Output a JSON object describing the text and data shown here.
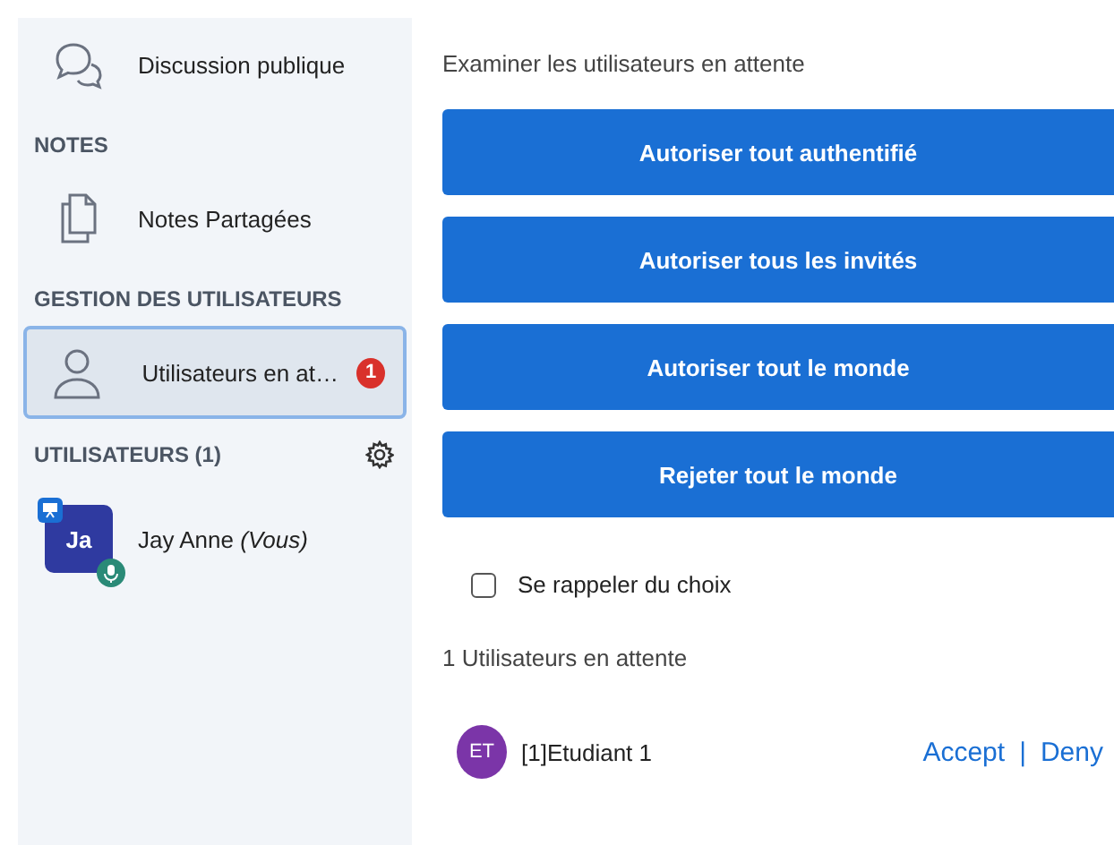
{
  "sidebar": {
    "items": [
      {
        "kind": "chat",
        "label": "Discussion publique",
        "selected": false
      },
      {
        "kind": "header",
        "label": "NOTES"
      },
      {
        "kind": "notes",
        "label": "Notes Partagées",
        "selected": false
      },
      {
        "kind": "header",
        "label": "GESTION DES UTILISATEURS"
      },
      {
        "kind": "user",
        "label": "Utilisateurs en at…",
        "selected": true,
        "badge": "1"
      }
    ],
    "users_header": "UTILISATEURS (1)",
    "users": [
      {
        "initials": "Ja",
        "name": "Jay Anne",
        "suffix": "(Vous)",
        "color": "#2f3aa0",
        "presenter": true
      }
    ]
  },
  "main": {
    "title": "Examiner les utilisateurs en attente",
    "buttons": [
      "Autoriser tout authentifié",
      "Autoriser tous les invités",
      "Autoriser tout le monde",
      "Rejeter tout le monde"
    ],
    "remember": {
      "label": "Se rappeler du choix",
      "checked": false
    },
    "waiting_count": "1 Utilisateurs en attente",
    "waiting": [
      {
        "initials": "ET",
        "name": "[1]Etudiant 1",
        "color": "#7b35a8",
        "accept": "Accept",
        "separator": "|",
        "deny": "Deny"
      }
    ]
  }
}
